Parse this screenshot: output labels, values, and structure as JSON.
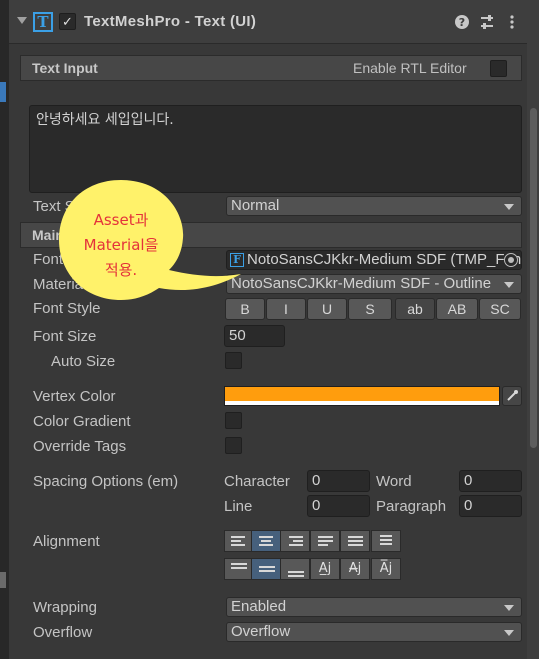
{
  "component": {
    "title": "TextMeshPro - Text (UI)",
    "icon_letter": "T",
    "enabled": true,
    "header_icons": [
      "help-icon",
      "presets-icon",
      "kebab-menu-icon"
    ]
  },
  "text_input": {
    "section_label": "Text Input",
    "rtl_label": "Enable RTL Editor",
    "rtl_checked": false,
    "value": "안녕하세요 세입입니다."
  },
  "text_style": {
    "label": "Text Style",
    "value": "Normal"
  },
  "main_settings": {
    "section_label": "Main Settings"
  },
  "font_asset": {
    "label": "Font Asset",
    "value": "NotoSansCJKkr-Medium SDF (TMP_Font Asset)"
  },
  "material_preset": {
    "label": "Material Preset",
    "value": "NotoSansCJKkr-Medium SDF - Outline"
  },
  "font_style": {
    "label": "Font Style",
    "buttons": [
      "B",
      "I",
      "U",
      "S",
      "ab",
      "AB",
      "SC"
    ]
  },
  "font_size": {
    "label": "Font Size",
    "value": "50"
  },
  "auto_size": {
    "label": "Auto Size",
    "checked": false
  },
  "vertex_color": {
    "label": "Vertex Color",
    "color": "#ff9d0d"
  },
  "color_gradient": {
    "label": "Color Gradient",
    "checked": false
  },
  "override_tags": {
    "label": "Override Tags",
    "checked": false
  },
  "spacing": {
    "label": "Spacing Options (em)",
    "character_label": "Character",
    "character_value": "0",
    "word_label": "Word",
    "word_value": "0",
    "line_label": "Line",
    "line_value": "0",
    "paragraph_label": "Paragraph",
    "paragraph_value": "0"
  },
  "alignment": {
    "label": "Alignment",
    "horizontal": [
      "left",
      "center",
      "right",
      "justified",
      "flush",
      "geometry-center"
    ],
    "horizontal_selected": "center",
    "vertical": [
      "top",
      "middle",
      "bottom",
      "baseline",
      "midline",
      "capline"
    ],
    "vertical_selected": "middle"
  },
  "wrapping": {
    "label": "Wrapping",
    "value": "Enabled"
  },
  "overflow": {
    "label": "Overflow",
    "value": "Overflow"
  },
  "callout": {
    "line1": "Asset과",
    "line2": "Material을",
    "line3": "적용.",
    "fill_color": "#fff26a",
    "text_color": "#e4323a"
  }
}
